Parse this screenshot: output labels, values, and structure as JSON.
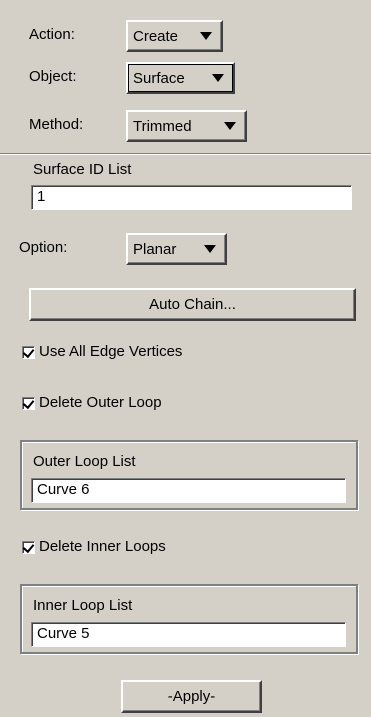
{
  "action": {
    "label": "Action:",
    "value": "Create"
  },
  "object": {
    "label": "Object:",
    "value": "Surface"
  },
  "method": {
    "label": "Method:",
    "value": "Trimmed"
  },
  "surface_id": {
    "label": "Surface ID List",
    "value": "1"
  },
  "option": {
    "label": "Option:",
    "value": "Planar"
  },
  "auto_chain": {
    "label": "Auto Chain..."
  },
  "use_all_edge_vertices": {
    "label": "Use All Edge Vertices",
    "checked": true
  },
  "delete_outer_loop": {
    "label": "Delete Outer Loop",
    "checked": true
  },
  "outer_loop": {
    "label": "Outer Loop List",
    "value": "Curve 6"
  },
  "delete_inner_loops": {
    "label": "Delete Inner Loops",
    "checked": true
  },
  "inner_loop": {
    "label": "Inner Loop List",
    "value": "Curve 5"
  },
  "apply": {
    "label": "-Apply-"
  },
  "icons": {
    "dropdown": "chevron-down-icon",
    "check": "checkmark-icon"
  }
}
